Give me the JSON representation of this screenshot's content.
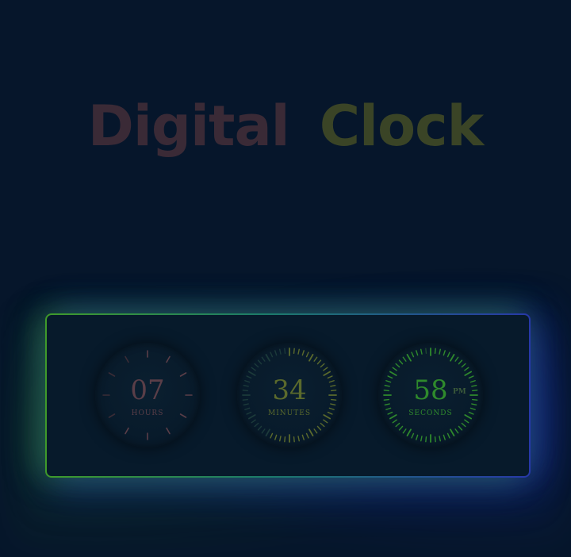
{
  "title": {
    "word1": "Digital",
    "word2": "Clock"
  },
  "clock": {
    "hours": {
      "value": "07",
      "label": "HOURS"
    },
    "minutes": {
      "value": "34",
      "label": "MINUTES"
    },
    "seconds": {
      "value": "58",
      "label": "SECONDS"
    },
    "period": "PM"
  },
  "colors": {
    "background": "#06162b",
    "hours_accent": "#5a3e48",
    "minutes_accent": "#5b6a2c",
    "seconds_accent": "#2f8a2c",
    "glow_left": "#3f9a2a",
    "glow_right": "#2738a8"
  }
}
